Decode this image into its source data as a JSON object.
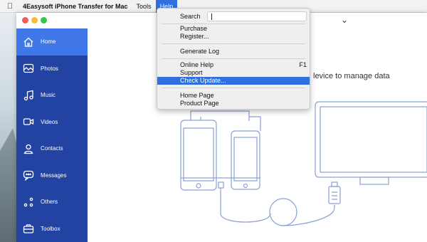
{
  "menubar": {
    "apple_icon": "apple-logo",
    "app_name": "4Easysoft iPhone Transfer for Mac",
    "tools_label": "Tools",
    "help_label": "Help"
  },
  "sidebar": {
    "items": [
      {
        "label": "Home",
        "icon": "home-icon"
      },
      {
        "label": "Photos",
        "icon": "photos-icon"
      },
      {
        "label": "Music",
        "icon": "music-icon"
      },
      {
        "label": "Videos",
        "icon": "videos-icon"
      },
      {
        "label": "Contacts",
        "icon": "contacts-icon"
      },
      {
        "label": "Messages",
        "icon": "messages-icon"
      },
      {
        "label": "Others",
        "icon": "others-icon"
      },
      {
        "label": "Toolbox",
        "icon": "toolbox-icon"
      }
    ]
  },
  "main": {
    "connect_text": "levice to manage data"
  },
  "help_menu": {
    "search_label": "Search",
    "search_value": "",
    "items": {
      "purchase": "Purchase",
      "register": "Register...",
      "generate_log": "Generate Log",
      "online_help": "Online Help",
      "online_help_shortcut": "F1",
      "support": "Support",
      "check_update": "Check Update...",
      "home_page": "Home Page",
      "product_page": "Product Page"
    },
    "highlighted": "Check Update..."
  },
  "colors": {
    "sidebar_bg": "#2343a3",
    "sidebar_active": "#3f77e8",
    "menu_highlight": "#2f6fde",
    "illustration_stroke": "#8aa0d6"
  }
}
